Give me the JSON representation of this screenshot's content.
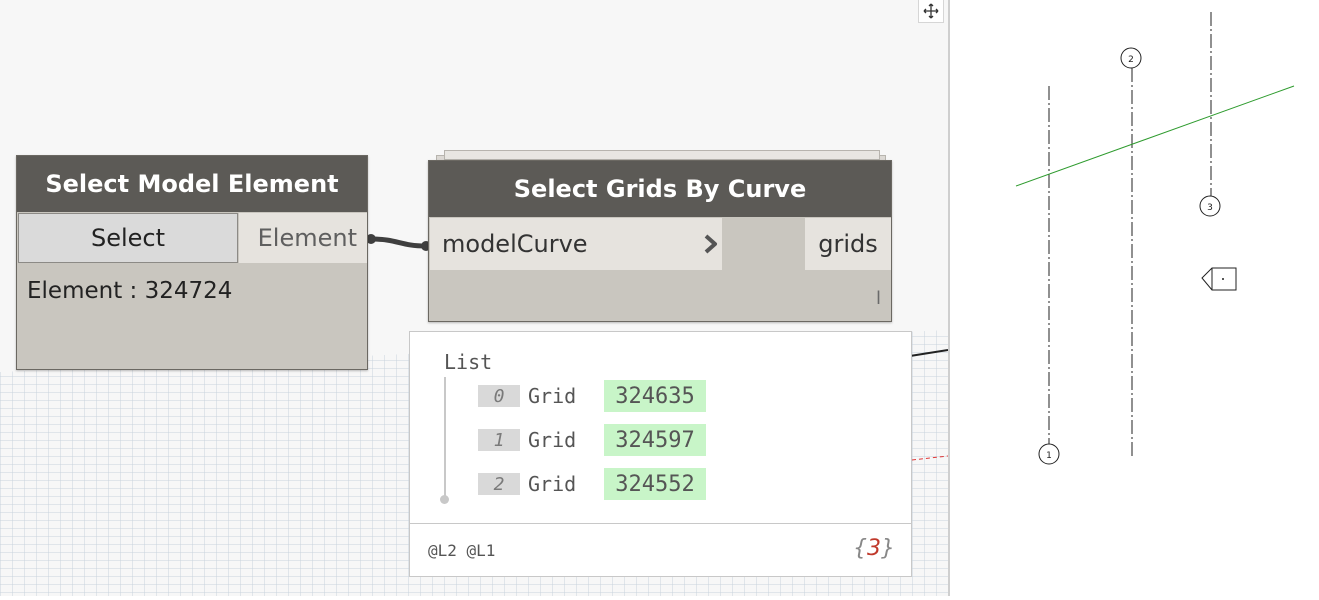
{
  "node_select_model_element": {
    "title": "Select Model Element",
    "select_button_label": "Select",
    "output_port": "Element",
    "preview": "Element : 324724"
  },
  "node_select_grids": {
    "title": "Select Grids By Curve",
    "input_port": "modelCurve",
    "output_port": "grids",
    "lacing": "l"
  },
  "watch_preview": {
    "header": "List",
    "items": [
      {
        "index": "0",
        "type": "Grid",
        "value": "324635"
      },
      {
        "index": "1",
        "type": "Grid",
        "value": "324597"
      },
      {
        "index": "2",
        "type": "Grid",
        "value": "324552"
      }
    ],
    "levels": "@L2 @L1",
    "count_open": "{",
    "count": "3",
    "count_close": "}"
  },
  "revit_view": {
    "grid_bubbles": [
      "1",
      "2",
      "3"
    ],
    "curve_color": "#2e9b2e",
    "grid_line_color": "#222222"
  },
  "colors": {
    "node_header": "#5c5a56",
    "node_body": "#c9c6bf",
    "value_highlight": "#c8f5c8"
  }
}
